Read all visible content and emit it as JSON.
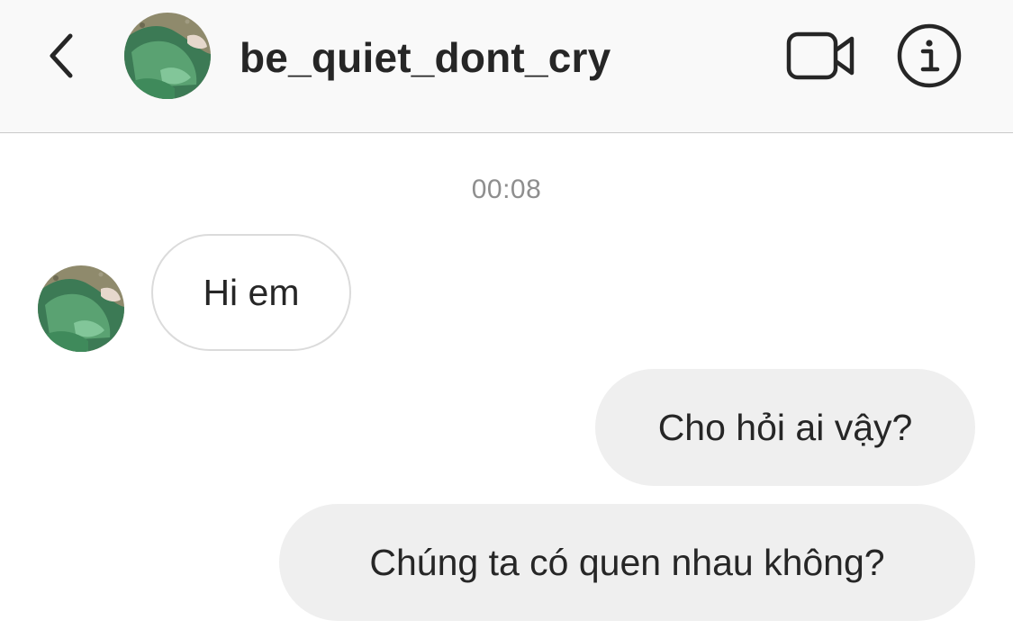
{
  "header": {
    "back_icon": "chevron-left-icon",
    "username": "be_quiet_dont_cry",
    "video_icon": "video-camera-icon",
    "info_icon": "info-icon"
  },
  "conversation": {
    "timestamp": "00:08",
    "messages": [
      {
        "direction": "incoming",
        "text": "Hi em"
      },
      {
        "direction": "outgoing",
        "text": "Cho hỏi ai vậy?"
      },
      {
        "direction": "outgoing",
        "text": "Chúng ta có quen nhau không?"
      }
    ]
  },
  "colors": {
    "header_bg": "#f9f9f9",
    "divider": "#c9c9c9",
    "text": "#262626",
    "timestamp": "#8e8e8e",
    "outgoing_bubble": "#efefef",
    "incoming_border": "#dbdbdb"
  }
}
